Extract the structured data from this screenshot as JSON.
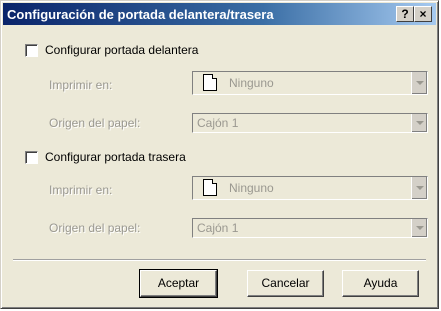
{
  "window": {
    "title": "Configuración de portada delantera/trasera",
    "help_glyph": "?",
    "close_glyph": "×"
  },
  "front_cover": {
    "checkbox_label": "Configurar portada delantera",
    "checked": false,
    "print_on_label": "Imprimir en:",
    "print_on_value": "Ninguno",
    "paper_source_label": "Origen del papel:",
    "paper_source_value": "Cajón 1"
  },
  "back_cover": {
    "checkbox_label": "Configurar portada trasera",
    "checked": false,
    "print_on_label": "Imprimir en:",
    "print_on_value": "Ninguno",
    "paper_source_label": "Origen del papel:",
    "paper_source_value": "Cajón 1"
  },
  "buttons": {
    "ok": "Aceptar",
    "cancel": "Cancelar",
    "help": "Ayuda"
  },
  "icons": {
    "paper": "paper-sheet-icon",
    "dropdown": "chevron-down-icon"
  }
}
